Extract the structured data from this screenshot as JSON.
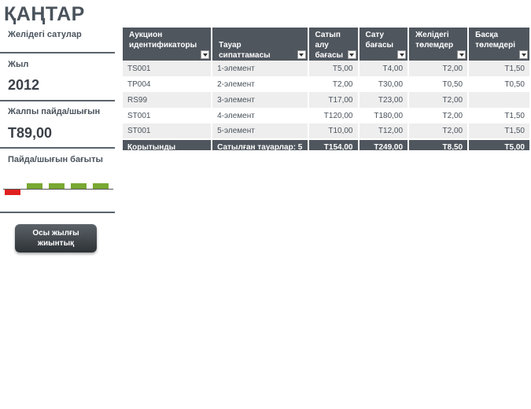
{
  "header": {
    "title": "ҚАҢТАР",
    "subtitle": "Желідегі сатулар"
  },
  "summary": {
    "year_label": "Жыл",
    "year_value": "2012",
    "profit_label": "Жалпы пайда/шығын",
    "profit_value": "Т89,00",
    "trend_label": "Пайда/шығын бағыты",
    "trend_values": [
      -1,
      1,
      1,
      1,
      1
    ],
    "trend_colors": {
      "negative": "#e02020",
      "positive": "#78a832"
    },
    "button_label": "Осы жылғы жиынтық"
  },
  "table": {
    "columns": [
      "Аукцион идентификаторы",
      "Тауар сипаттамасы",
      "Сатып алу бағасы",
      "Сату бағасы",
      "Желідегі төлемдер",
      "Басқа төлемдері"
    ],
    "rows": [
      [
        "TS001",
        "1-элемент",
        "Т5,00",
        "Т4,00",
        "Т2,00",
        "Т1,50"
      ],
      [
        "TP004",
        "2-элемент",
        "Т2,00",
        "Т30,00",
        "Т0,50",
        "Т0,50"
      ],
      [
        "RS99",
        "3-элемент",
        "Т17,00",
        "Т23,00",
        "Т2,00",
        ""
      ],
      [
        "ST001",
        "4-элемент",
        "Т120,00",
        "Т180,00",
        "Т2,00",
        "Т1,50"
      ],
      [
        "ST001",
        "5-элемент",
        "Т10,00",
        "Т12,00",
        "Т2,00",
        "Т1,50"
      ]
    ],
    "totals": [
      "Қорытынды",
      "Сатылған тауарлар: 5",
      "Т154,00",
      "Т249,00",
      "Т8,50",
      "Т5,00"
    ],
    "header_color": "#4f565e",
    "stripe_color": "#eeeeee"
  }
}
